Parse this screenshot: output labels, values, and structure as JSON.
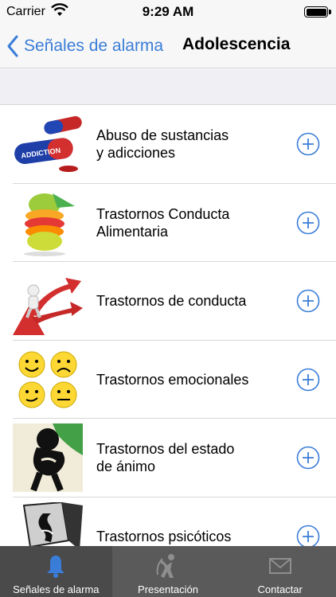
{
  "status_bar": {
    "carrier": "Carrier",
    "time": "9:29 AM"
  },
  "nav": {
    "back_label": "Señales de alarma",
    "title": "Adolescencia"
  },
  "accent_color": "#3a7dd8",
  "list": [
    {
      "label": "Abuso de sustancias\ny adicciones",
      "icon": "pills-icon"
    },
    {
      "label": "Trastornos Conducta\nAlimentaria",
      "icon": "fruit-stack-icon"
    },
    {
      "label": "Trastornos de conducta",
      "icon": "crossroads-arrows-icon"
    },
    {
      "label": "Trastornos emocionales",
      "icon": "emoji-faces-icon"
    },
    {
      "label": "Trastornos del estado\nde ánimo",
      "icon": "sad-figure-icon"
    },
    {
      "label": "Trastornos psicóticos",
      "icon": "face-silhouette-icon"
    }
  ],
  "tabs": [
    {
      "label": "Señales de alarma",
      "icon": "bell-icon",
      "active": true
    },
    {
      "label": "Presentación",
      "icon": "person-icon",
      "active": false
    },
    {
      "label": "Contactar",
      "icon": "envelope-icon",
      "active": false
    }
  ]
}
